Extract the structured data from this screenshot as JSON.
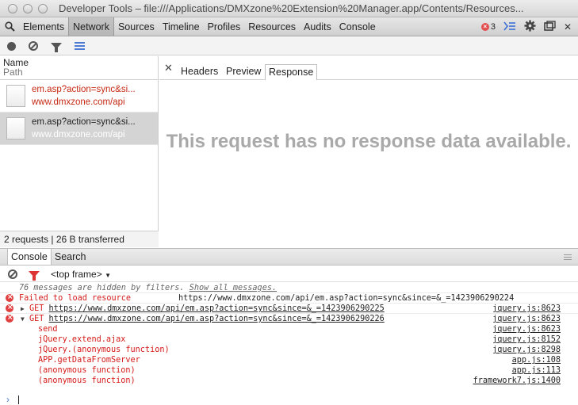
{
  "window": {
    "title": "Developer Tools – file:///Applications/DMXzone%20Extension%20Manager.app/Contents/Resources..."
  },
  "toolbar": {
    "tabs": [
      "Elements",
      "Network",
      "Sources",
      "Timeline",
      "Profiles",
      "Resources",
      "Audits",
      "Console"
    ],
    "active_tab": "Network",
    "error_count": "3"
  },
  "requests": {
    "column_name": "Name",
    "column_path": "Path",
    "items": [
      {
        "name": "em.asp?action=sync&si...",
        "host": "www.dmxzone.com/api"
      },
      {
        "name": "em.asp?action=sync&si...",
        "host": "www.dmxzone.com/api"
      }
    ],
    "summary": "2 requests | 26 B transferred"
  },
  "detail": {
    "tabs": [
      "Headers",
      "Preview",
      "Response"
    ],
    "active_tab": "Response",
    "empty_message": "This request has no response data available."
  },
  "drawer": {
    "tabs": [
      "Console",
      "Search"
    ],
    "active_tab": "Console",
    "frame_selector": "<top frame>"
  },
  "console": {
    "hidden_prefix": "76 messages are hidden by filters.",
    "hidden_link": "Show all messages.",
    "failed_msg": "Failed to load resource",
    "failed_url": "https://www.dmxzone.com/api/em.asp?action=sync&since=&_=1423906290224",
    "get1_method": "GET",
    "get1_url": "https://www.dmxzone.com/api/em.asp?action=sync&since=&_=1423906290225",
    "get1_src": "jquery.js:8623",
    "get2_method": "GET",
    "get2_url": "https://www.dmxzone.com/api/em.asp?action=sync&since=&_=1423906290226",
    "get2_src": "jquery.js:8623",
    "stack": [
      {
        "fn": "send",
        "src": "jquery.js:8623"
      },
      {
        "fn": "jQuery.extend.ajax",
        "src": "jquery.js:8152"
      },
      {
        "fn": "jQuery.(anonymous function)",
        "src": "jquery.js:8298"
      },
      {
        "fn": "APP.getDataFromServer",
        "src": "app.js:108"
      },
      {
        "fn": "(anonymous function)",
        "src": "app.js:113"
      },
      {
        "fn": "(anonymous function)",
        "src": "framework7.js:1400"
      }
    ]
  }
}
